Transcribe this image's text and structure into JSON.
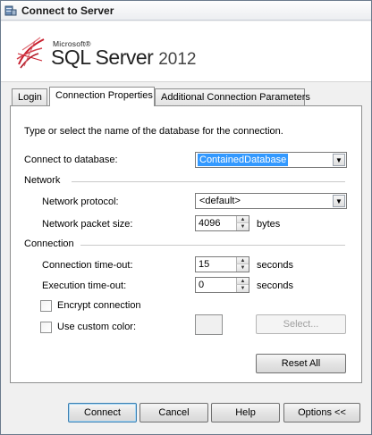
{
  "window": {
    "title": "Connect to Server"
  },
  "brand": {
    "vendor": "Microsoft®",
    "product": "SQL Server",
    "version": "2012"
  },
  "tabs": [
    {
      "label": "Login"
    },
    {
      "label": "Connection Properties"
    },
    {
      "label": "Additional Connection Parameters"
    }
  ],
  "panel": {
    "instruction": "Type or select the name of the database for the connection.",
    "connect_db": {
      "label": "Connect to database:",
      "value": "ContainedDatabase"
    },
    "network": {
      "group_label": "Network",
      "protocol": {
        "label": "Network protocol:",
        "value": "<default>"
      },
      "packet_size": {
        "label": "Network packet size:",
        "value": "4096",
        "unit": "bytes"
      }
    },
    "connection": {
      "group_label": "Connection",
      "timeout": {
        "label": "Connection time-out:",
        "value": "15",
        "unit": "seconds"
      },
      "exec_timeout": {
        "label": "Execution time-out:",
        "value": "0",
        "unit": "seconds"
      },
      "encrypt": {
        "label": "Encrypt connection",
        "checked": false
      },
      "custom_color": {
        "label": "Use custom color:",
        "checked": false
      }
    },
    "select_button": "Select...",
    "reset_button": "Reset All"
  },
  "buttons": {
    "connect": "Connect",
    "cancel": "Cancel",
    "help": "Help",
    "options": "Options <<"
  },
  "colors": {
    "selection": "#3399ff",
    "swatch": "#f0f0f0",
    "logo_red": "#c8202f"
  }
}
